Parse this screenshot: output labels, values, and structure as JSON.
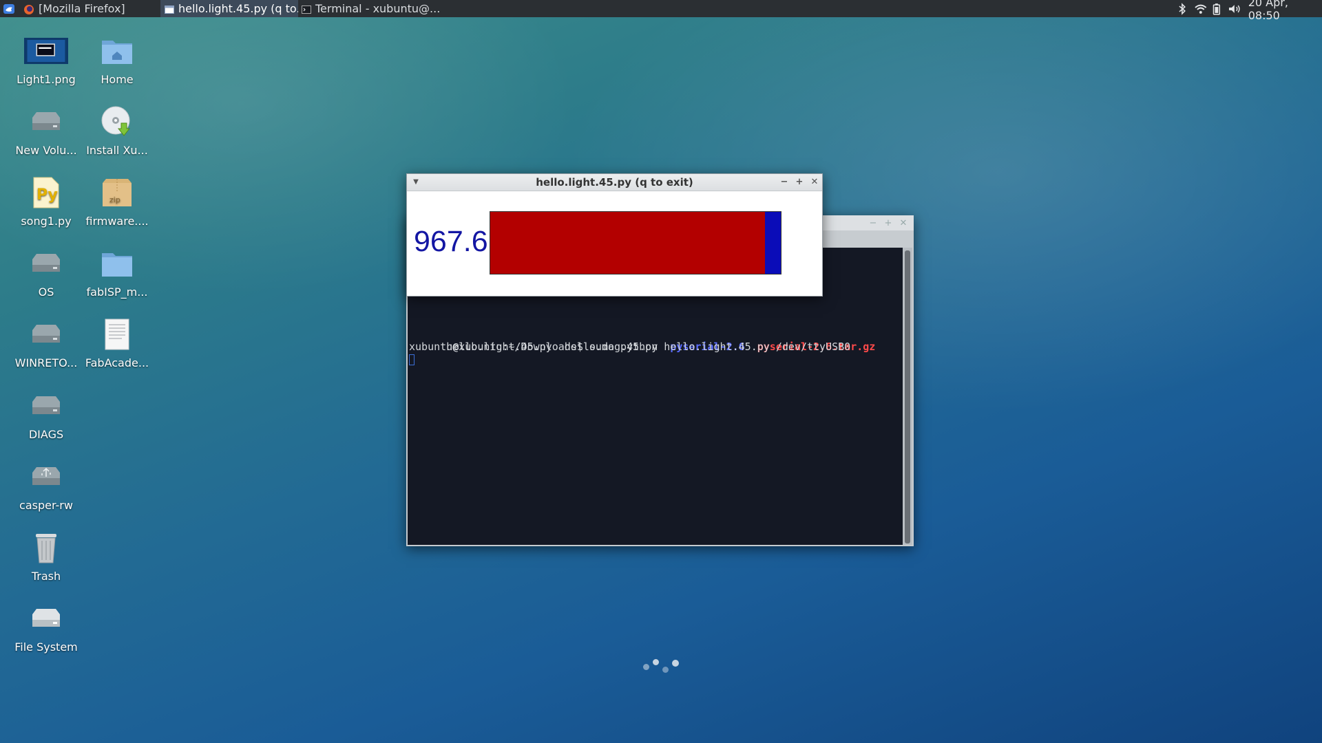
{
  "panel": {
    "taskbar": [
      {
        "label": "[Mozilla Firefox]",
        "icon": "firefox-icon",
        "active": false
      },
      {
        "label": "hello.light.45.py (q to...",
        "icon": "window-icon",
        "active": true
      },
      {
        "label": "Terminal - xubuntu@...",
        "icon": "terminal-icon",
        "active": false
      }
    ],
    "clock": "20 Apr, 08:50"
  },
  "desktop_icons": [
    {
      "label": "Light1.png",
      "icon": "image-file-icon"
    },
    {
      "label": "Home",
      "icon": "home-folder-icon"
    },
    {
      "label": "New Volu...",
      "icon": "drive-icon"
    },
    {
      "label": "Install Xu...",
      "icon": "install-disc-icon"
    },
    {
      "label": "song1.py",
      "icon": "python-file-icon"
    },
    {
      "label": "firmware....",
      "icon": "zip-archive-icon"
    },
    {
      "label": "OS",
      "icon": "drive-icon"
    },
    {
      "label": "fabISP_m...",
      "icon": "folder-icon"
    },
    {
      "label": "WINRETO...",
      "icon": "drive-icon"
    },
    {
      "label": "FabAcade...",
      "icon": "document-icon"
    },
    {
      "label": "DIAGS",
      "icon": "drive-icon"
    },
    {
      "label": "casper-rw",
      "icon": "usb-drive-icon"
    },
    {
      "label": "Trash",
      "icon": "trash-icon"
    },
    {
      "label": "File System",
      "icon": "drive-icon"
    }
  ],
  "light_window": {
    "title": "hello.light.45.py (q to exit)",
    "reading": "967.6",
    "bar_fraction": 0.945,
    "bar_fill_color": "#b30000",
    "bar_bg_color": "#0a0cb8"
  },
  "terminal": {
    "listing": [
      {
        "text": "hello.light.45.py",
        "color": "#d5d8dc",
        "bold": false
      },
      {
        "text": "hello.mag.45.py",
        "color": "#d5d8dc",
        "bold": false
      },
      {
        "text": "pyserial-2.6",
        "color": "#5a6cff",
        "bold": true
      },
      {
        "text": "pyserial-2.6.tar.gz",
        "color": "#ff4a4a",
        "bold": true
      }
    ],
    "prompt_line": "xubuntu@xubuntu:~/Downloads$ sudo python hello.light.45.py /dev/ttyUSB0"
  }
}
